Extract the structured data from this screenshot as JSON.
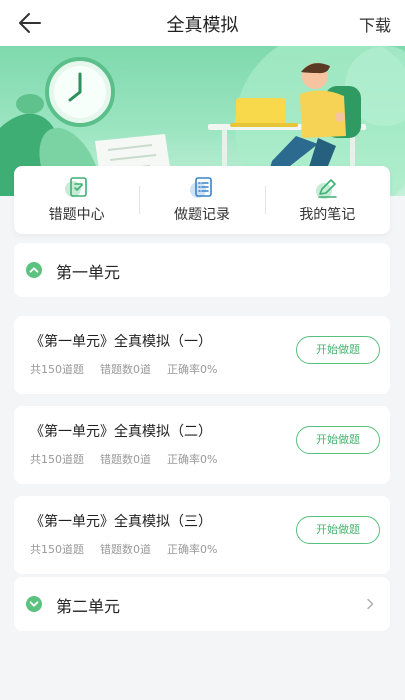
{
  "navbar": {
    "title": "全真模拟",
    "action_label": "下载"
  },
  "quick_links": [
    {
      "label": "错题中心",
      "icon": "mistakes-icon"
    },
    {
      "label": "做题记录",
      "icon": "records-icon"
    },
    {
      "label": "我的笔记",
      "icon": "notes-icon"
    }
  ],
  "units": [
    {
      "name": "第一单元",
      "expanded": true
    },
    {
      "name": "第二单元",
      "expanded": false
    }
  ],
  "exams": [
    {
      "title": "《第一单元》全真模拟（一）",
      "total": "共150道题",
      "wrong": "错题数0道",
      "accuracy": "正确率0%",
      "button_label": "开始做题"
    },
    {
      "title": "《第一单元》全真模拟（二）",
      "total": "共150道题",
      "wrong": "错题数0道",
      "accuracy": "正确率0%",
      "button_label": "开始做题"
    },
    {
      "title": "《第一单元》全真模拟（三）",
      "total": "共150道题",
      "wrong": "错题数0道",
      "accuracy": "正确率0%",
      "button_label": "开始做题"
    }
  ],
  "colors": {
    "accent": "#48b570",
    "banner": "#8fdfb7",
    "background": "#f4f5f7"
  }
}
